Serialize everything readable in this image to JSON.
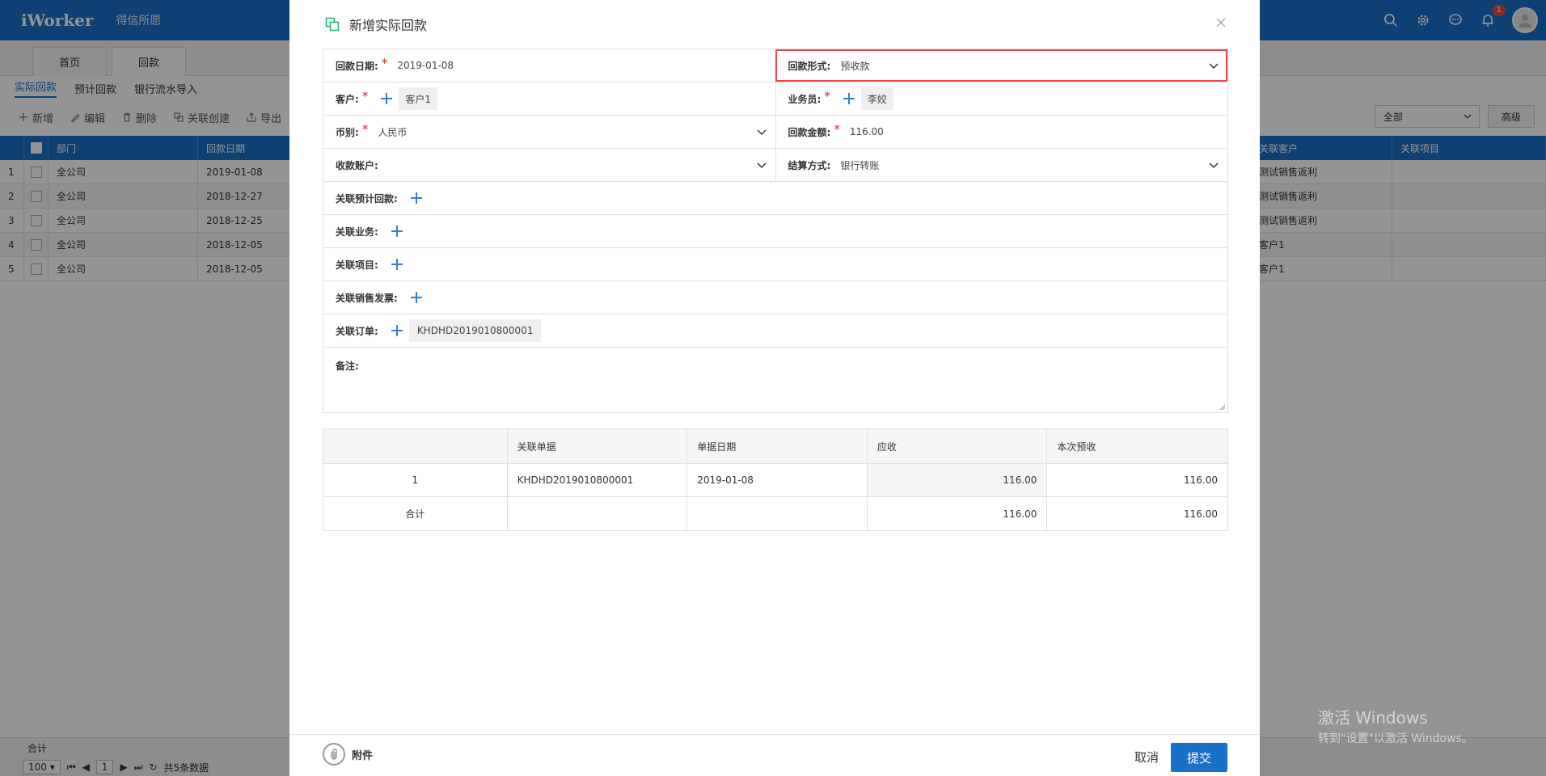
{
  "app": {
    "logo": "iWorker",
    "company": "得信所愿",
    "notification_count": "1"
  },
  "nav_tabs": [
    "首页",
    "回款"
  ],
  "sub_tabs": [
    "实际回款",
    "预计回款",
    "银行流水导入"
  ],
  "toolbar": {
    "add": "新增",
    "edit": "编辑",
    "delete": "删除",
    "link_create": "关联创建",
    "export": "导出",
    "filter_value": "全部",
    "advanced": "高级"
  },
  "grid": {
    "headers": {
      "dept": "部门",
      "date": "回款日期",
      "customer": "关联客户",
      "project": "关联项目"
    },
    "rows": [
      {
        "n": "1",
        "dept": "全公司",
        "date": "2019-01-08",
        "customer": "测试销售返利",
        "project": ""
      },
      {
        "n": "2",
        "dept": "全公司",
        "date": "2018-12-27",
        "customer": "测试销售返利",
        "project": ""
      },
      {
        "n": "3",
        "dept": "全公司",
        "date": "2018-12-25",
        "customer": "测试销售返利",
        "project": ""
      },
      {
        "n": "4",
        "dept": "全公司",
        "date": "2018-12-05",
        "customer": "客户1",
        "project": ""
      },
      {
        "n": "5",
        "dept": "全公司",
        "date": "2018-12-05",
        "customer": "客户1",
        "project": ""
      }
    ],
    "sum_label": "合计",
    "pager": {
      "page_size": "100",
      "page": "1",
      "total_text": "共5条数据"
    }
  },
  "watermark": {
    "line1": "激活 Windows",
    "line2": "转到\"设置\"以激活 Windows。"
  },
  "modal": {
    "title": "新增实际回款",
    "form": {
      "payment_date_label": "回款日期:",
      "payment_date": "2019-01-08",
      "payment_form_label": "回款形式:",
      "payment_form": "预收款",
      "customer_label": "客户:",
      "customer": "客户1",
      "salesperson_label": "业务员:",
      "salesperson": "李姣",
      "currency_label": "币别:",
      "currency": "人民币",
      "amount_label": "回款金额:",
      "amount": "116.00",
      "account_label": "收款账户:",
      "account": "",
      "settlement_label": "结算方式:",
      "settlement": "银行转账",
      "link_forecast_label": "关联预计回款:",
      "link_business_label": "关联业务:",
      "link_project_label": "关联项目:",
      "link_invoice_label": "关联销售发票:",
      "link_order_label": "关联订单:",
      "link_order": "KHDHD2019010800001",
      "notes_label": "备注:"
    },
    "detail": {
      "headers": [
        "",
        "关联单据",
        "单据日期",
        "应收",
        "本次预收"
      ],
      "rows": [
        [
          "1",
          "KHDHD2019010800001",
          "2019-01-08",
          "116.00",
          "116.00"
        ]
      ],
      "total": [
        "合计",
        "",
        "",
        "116.00",
        "116.00"
      ]
    },
    "footer": {
      "attach": "附件",
      "cancel": "取消",
      "submit": "提交"
    }
  }
}
